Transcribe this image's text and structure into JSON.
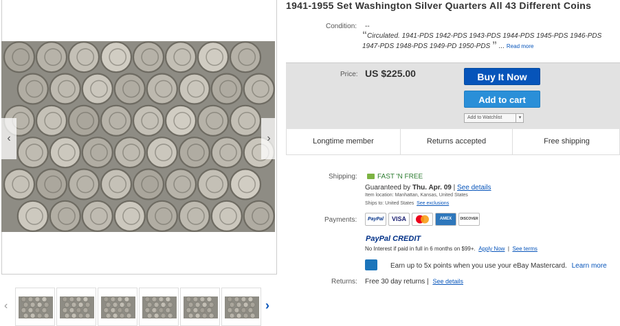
{
  "listing": {
    "title": "1941-1955 Set Washington Silver Quarters All 43 Different Coins",
    "condition_label": "Condition:",
    "condition_value": "--",
    "condition_open_quote": "“",
    "condition_desc": "Circulated. 1941-PDS 1942-PDS 1943-PDS 1944-PDS 1945-PDS 1946-PDS 1947-PDS 1948-PDS 1949-PD 1950-PDS",
    "condition_close_quote": "”",
    "condition_ellipsis": "...",
    "read_more": "Read more"
  },
  "gallery": {
    "prev_arrow": "‹",
    "next_arrow": "›",
    "thumb_prev": "‹",
    "thumb_next": "›",
    "thumb_count": 6
  },
  "purchase": {
    "price_label": "Price:",
    "price": "US $225.00",
    "buy_now": "Buy It Now",
    "add_to_cart": "Add to cart",
    "watchlist": "Add to Watchlist",
    "watch_dropdown": "▾"
  },
  "badges": [
    "Longtime member",
    "Returns accepted",
    "Free shipping"
  ],
  "shipping": {
    "label": "Shipping:",
    "fast": "FAST 'N FREE",
    "guaranteed_prefix": "Guaranteed by",
    "guaranteed_date": "Thu. Apr. 09",
    "separator": "|",
    "see_details": "See details",
    "item_location": "Item location:  Manhattan, Kansas, United States",
    "ships_to": "Ships to:  United States",
    "see_exclusions": "See exclusions"
  },
  "payments": {
    "label": "Payments:",
    "logos": [
      "PayPal",
      "VISA",
      "MC",
      "AMEX",
      "DISCOVER"
    ],
    "paypal_credit_1": "PayPal",
    "paypal_credit_2": "CREDIT",
    "no_interest": "No Interest if paid in full in 6 months on $99+.",
    "apply_now": "Apply Now",
    "sep": "|",
    "see_terms": "See terms",
    "earn_text": "Earn up to 5x points when you use your eBay Mastercard.",
    "learn_more": "Learn more"
  },
  "returns": {
    "label": "Returns:",
    "value": "Free 30 day returns |",
    "see_details": "See details"
  },
  "colors": {
    "buy_button": "#0654ba",
    "cart_button": "#2a8fd8",
    "link": "#0654ba",
    "price_box": "#e2e2e2"
  }
}
